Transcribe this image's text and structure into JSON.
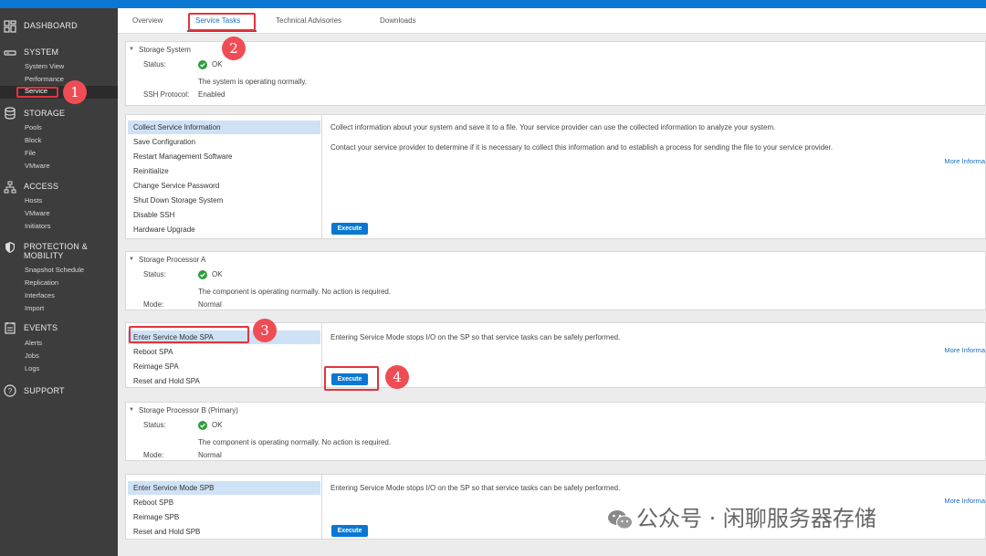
{
  "sidebar": {
    "dashboard": "DASHBOARD",
    "system": {
      "label": "SYSTEM",
      "items": [
        "System View",
        "Performance",
        "Service"
      ]
    },
    "storage": {
      "label": "STORAGE",
      "items": [
        "Pools",
        "Block",
        "File",
        "VMware"
      ]
    },
    "access": {
      "label": "ACCESS",
      "items": [
        "Hosts",
        "VMware",
        "Initiators"
      ]
    },
    "protection": {
      "label_line1": "PROTECTION &",
      "label_line2": "MOBILITY",
      "items": [
        "Snapshot Schedule",
        "Replication",
        "Interfaces",
        "Import"
      ]
    },
    "events": {
      "label": "EVENTS",
      "items": [
        "Alerts",
        "Jobs",
        "Logs"
      ]
    },
    "support": "SUPPORT"
  },
  "tabs": [
    "Overview",
    "Service Tasks",
    "Technical Advisories",
    "Downloads"
  ],
  "storage_system": {
    "title": "Storage System",
    "status_label": "Status:",
    "status_value": "OK",
    "status_message": "The system is operating normally.",
    "ssh_label": "SSH Protocol:",
    "ssh_value": "Enabled",
    "tasks": [
      "Collect Service Information",
      "Save Configuration",
      "Restart Management Software",
      "Reinitialize",
      "Change Service Password",
      "Shut Down Storage System",
      "Disable SSH",
      "Hardware Upgrade"
    ],
    "desc1": "Collect information about your system and save it to a file. Your service provider can use the collected information to analyze your system.",
    "desc2": "Contact your service provider to determine if it is necessary to collect this information and to establish a process for sending the file to your service provider.",
    "more": "More Informa",
    "execute": "Execute"
  },
  "spa": {
    "title": "Storage Processor A",
    "status_label": "Status:",
    "status_value": "OK",
    "status_message": "The component is operating normally. No action is required.",
    "mode_label": "Mode:",
    "mode_value": "Normal",
    "tasks": [
      "Enter Service Mode SPA",
      "Reboot SPA",
      "Reimage SPA",
      "Reset and Hold SPA"
    ],
    "desc": "Entering Service Mode stops I/O on the SP so that service tasks can be safely performed.",
    "more": "More Informa",
    "execute": "Execute"
  },
  "spb": {
    "title": "Storage Processor B (Primary)",
    "status_label": "Status:",
    "status_value": "OK",
    "status_message": "The component is operating normally. No action is required.",
    "mode_label": "Mode:",
    "mode_value": "Normal",
    "tasks": [
      "Enter Service Mode SPB",
      "Reboot SPB",
      "Reimage SPB",
      "Reset and Hold SPB"
    ],
    "desc": "Entering Service Mode stops I/O on the SP so that service tasks can be safely performed.",
    "more": "More Informa",
    "execute": "Execute"
  },
  "annotations": [
    "1",
    "2",
    "3",
    "4"
  ],
  "watermark": "公众号 · 闲聊服务器存储",
  "colors": {
    "accent": "#0a78d2",
    "sidebar": "#3d3d3d",
    "marker": "#e2343c",
    "ok": "#2e9e3c",
    "selected": "#cfe2f5"
  }
}
